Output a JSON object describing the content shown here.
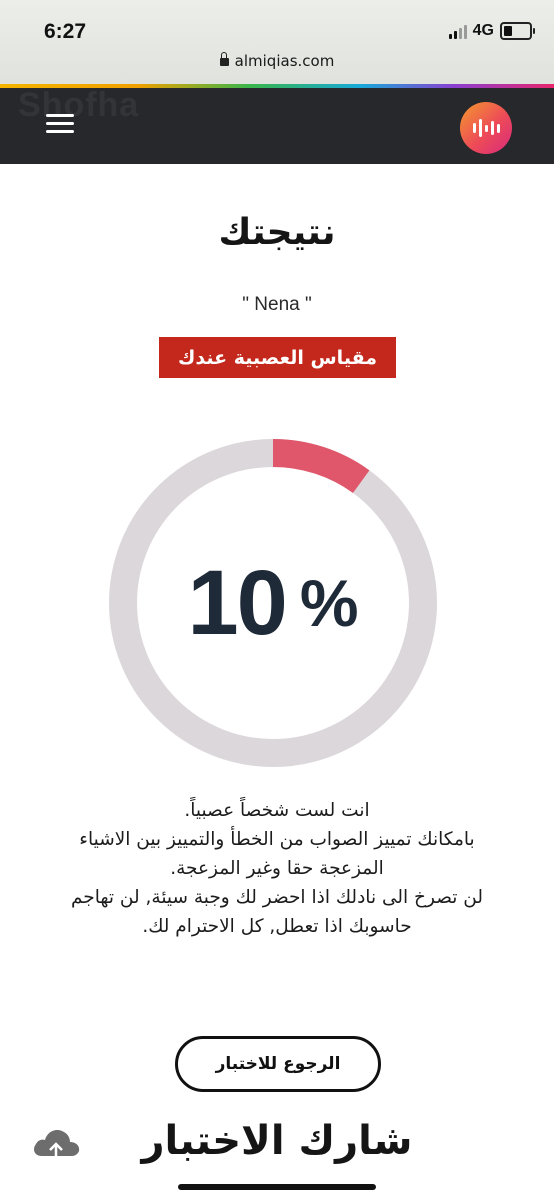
{
  "status_bar": {
    "time": "6:27",
    "network": "4G",
    "url": "almiqias.com"
  },
  "header": {
    "watermark": "Shofha",
    "menu_icon": "hamburger-menu-icon",
    "logo_icon": "sound-wave-logo-icon",
    "accent_colors": [
      "#f5b400",
      "#39b54a",
      "#17a9d9",
      "#8a3fd1",
      "#e8266c"
    ]
  },
  "result": {
    "title": "نتيجتك",
    "user_name": "\" Nena \"",
    "badge": "مقياس العصبية عندك",
    "badge_color": "#c4281c",
    "percent_value": 10,
    "gauge_number": "10",
    "gauge_unit": "%",
    "gauge_fill_color": "#e0566a",
    "gauge_track_color": "#dcd7da",
    "description": [
      "انت لست شخصاً عصبياً.",
      "بامكانك تمييز الصواب من الخطأ والتمييز بين الاشياء المزعجة حقا وغير المزعجة.",
      "لن تصرخ الى نادلك اذا احضر لك وجبة سيئة, لن تهاجم حاسوبك اذا تعطل, كل الاحترام لك."
    ]
  },
  "actions": {
    "back_button": "الرجوع للاختبار",
    "share_title": "شارك الاختبار",
    "upload_icon": "cloud-upload-icon"
  }
}
